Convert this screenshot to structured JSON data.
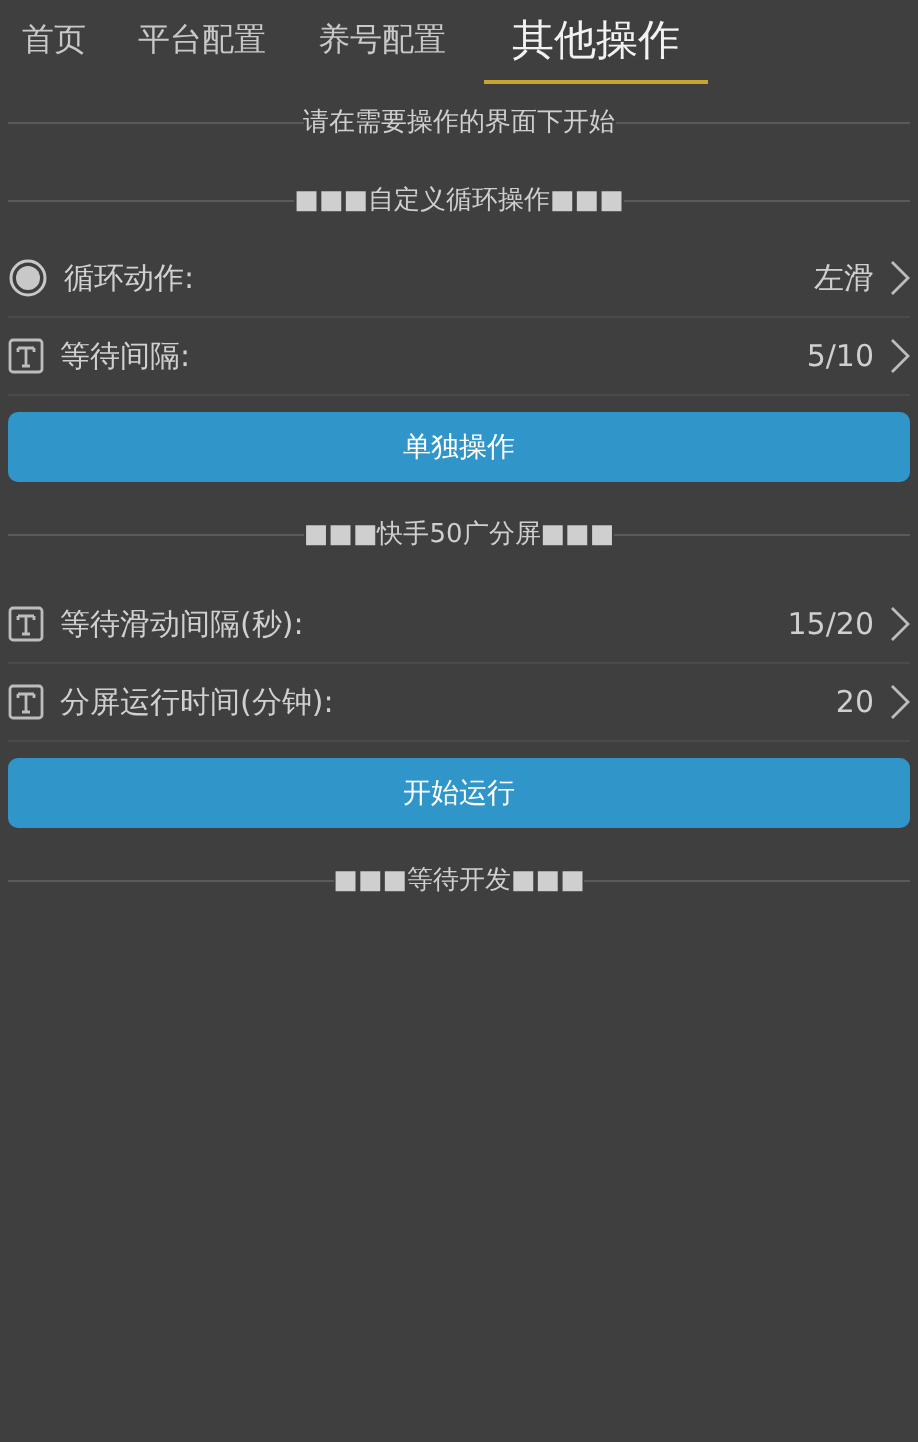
{
  "tabs": [
    {
      "label": "首页",
      "selected": false
    },
    {
      "label": "平台配置",
      "selected": false
    },
    {
      "label": "养号配置",
      "selected": false
    },
    {
      "label": "其他操作",
      "selected": true
    }
  ],
  "notice": "请在需要操作的界面下开始",
  "sections": [
    {
      "title": "■■■自定义循环操作■■■",
      "rows": [
        {
          "kind": "radio",
          "label": "循环动作:",
          "value": "左滑"
        },
        {
          "kind": "text",
          "label": "等待间隔:",
          "value": "5/10"
        }
      ],
      "button": "单独操作"
    },
    {
      "title": "■■■快手50广分屏■■■",
      "rows": [
        {
          "kind": "text",
          "label": "等待滑动间隔(秒):",
          "value": "15/20"
        },
        {
          "kind": "text",
          "label": "分屏运行时间(分钟):",
          "value": "20"
        }
      ],
      "button": "开始运行"
    },
    {
      "title": "■■■等待开发■■■"
    }
  ]
}
